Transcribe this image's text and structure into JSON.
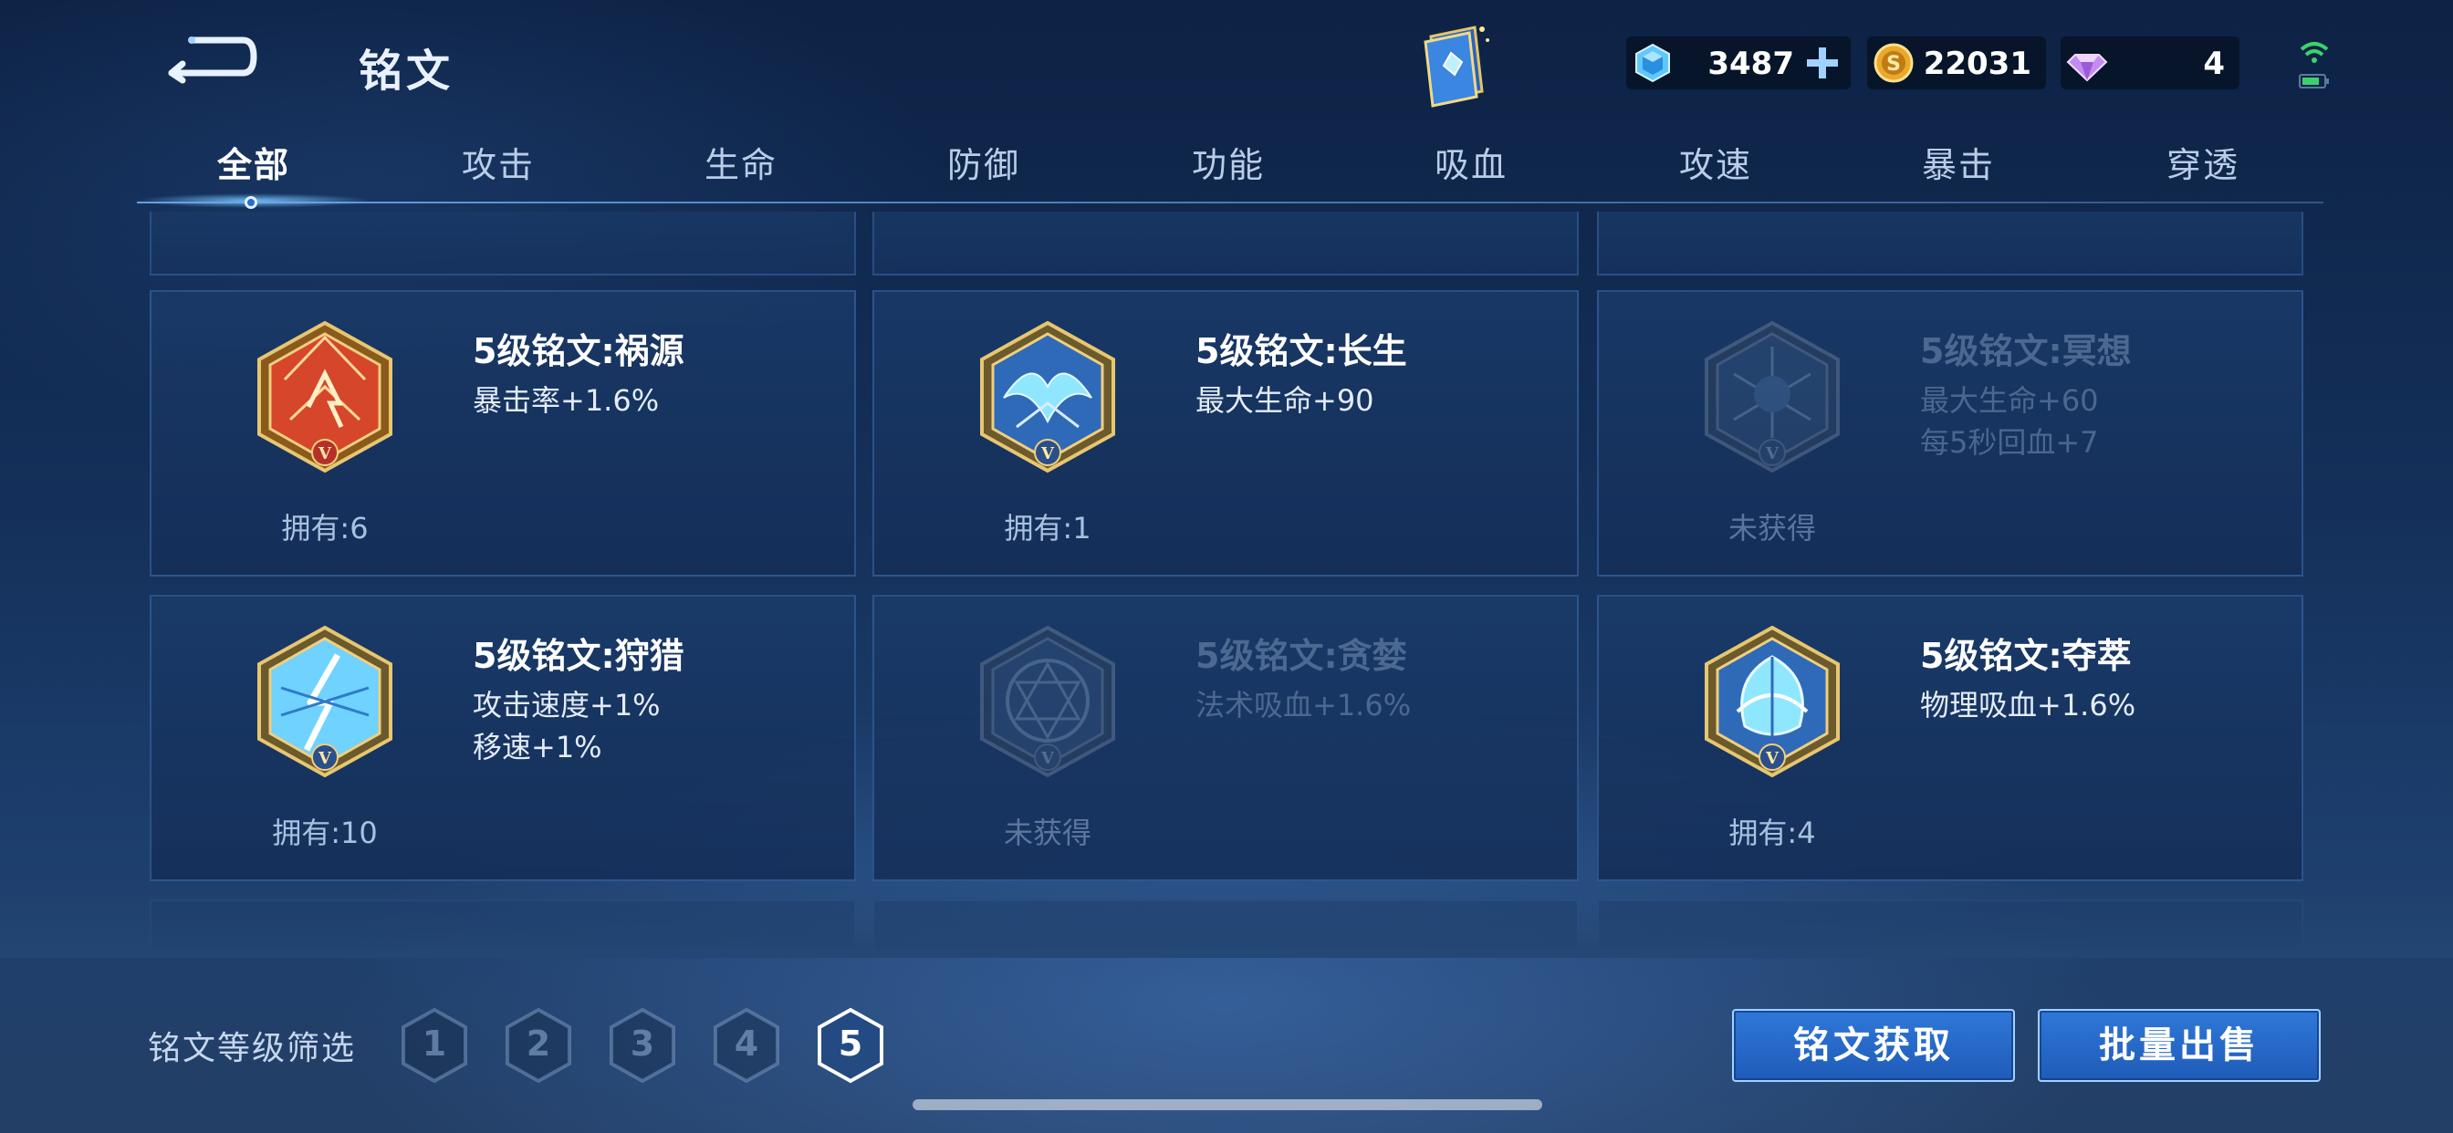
{
  "header": {
    "title": "铭文",
    "back_icon": "back-arrow-icon",
    "book_icon": "rune-book-icon"
  },
  "currencies": [
    {
      "name": "gem",
      "icon": "blue-crystal-icon",
      "value": "3487",
      "has_plus": true
    },
    {
      "name": "gold",
      "icon": "gold-coin-icon",
      "value": "22031"
    },
    {
      "name": "diamond",
      "icon": "purple-diamond-icon",
      "value": "4"
    }
  ],
  "status": {
    "icon": "wifi-battery-icon",
    "accent": "#3cd26a"
  },
  "tabs": [
    {
      "label": "全部",
      "active": true
    },
    {
      "label": "攻击"
    },
    {
      "label": "生命"
    },
    {
      "label": "防御"
    },
    {
      "label": "功能"
    },
    {
      "label": "吸血"
    },
    {
      "label": "攻速"
    },
    {
      "label": "暴击"
    },
    {
      "label": "穿透"
    }
  ],
  "runes": [
    {
      "name": "5级铭文:祸源",
      "attrs": [
        "暴击率+1.6%"
      ],
      "owned": "拥有:6",
      "locked": false,
      "color": "red"
    },
    {
      "name": "5级铭文:长生",
      "attrs": [
        "最大生命+90"
      ],
      "owned": "拥有:1",
      "locked": false,
      "color": "blue"
    },
    {
      "name": "5级铭文:冥想",
      "attrs": [
        "最大生命+60",
        "每5秒回血+7"
      ],
      "owned": "未获得",
      "locked": true,
      "color": "blue"
    },
    {
      "name": "5级铭文:狩猎",
      "attrs": [
        "攻击速度+1%",
        "移速+1%"
      ],
      "owned": "拥有:10",
      "locked": false,
      "color": "blue"
    },
    {
      "name": "5级铭文:贪婪",
      "attrs": [
        "法术吸血+1.6%"
      ],
      "owned": "未获得",
      "locked": true,
      "color": "blue"
    },
    {
      "name": "5级铭文:夺萃",
      "attrs": [
        "物理吸血+1.6%"
      ],
      "owned": "拥有:4",
      "locked": false,
      "color": "blue"
    }
  ],
  "filter": {
    "label": "铭文等级筛选",
    "levels": [
      "1",
      "2",
      "3",
      "4",
      "5"
    ],
    "active_level": "5"
  },
  "actions": {
    "acquire": "铭文获取",
    "bulk_sell": "批量出售"
  },
  "colors": {
    "accent_blue": "#2f78d8",
    "gold_frame": "#c9a04a",
    "red_gem": "#d6462a",
    "cyan_gem": "#8fe6ff"
  }
}
